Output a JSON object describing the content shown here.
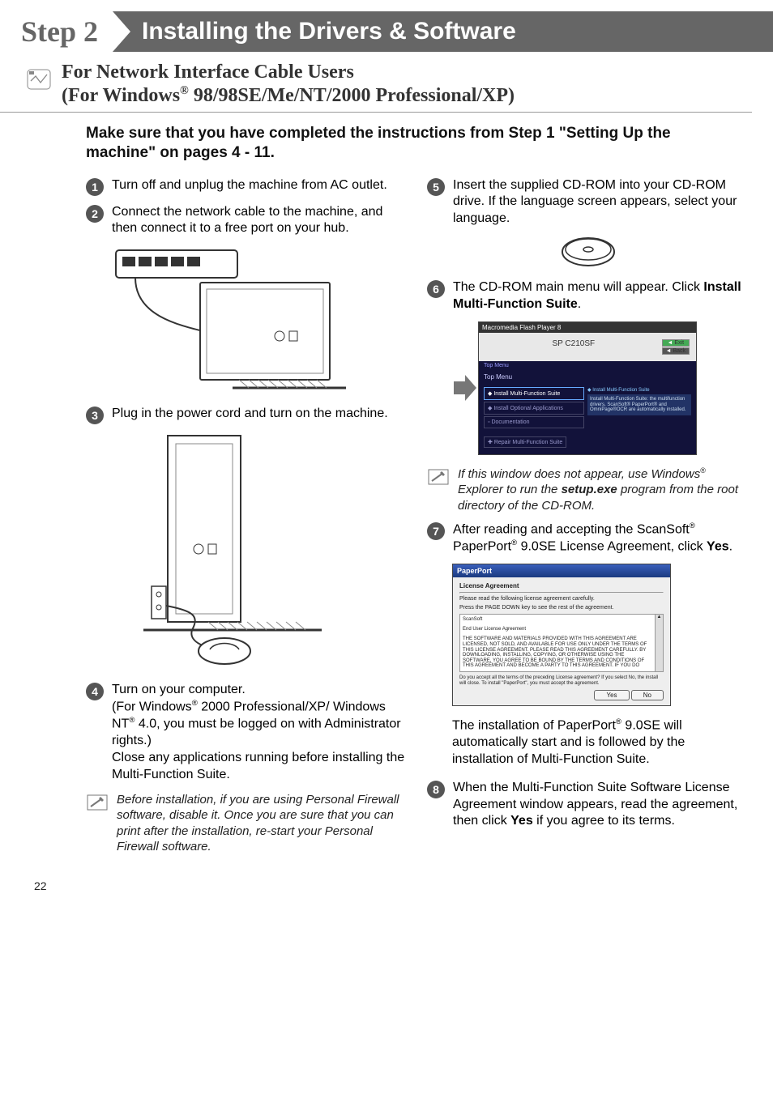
{
  "header": {
    "step_label": "Step 2",
    "title": "Installing the Drivers & Software"
  },
  "subhead": {
    "line1": "For Network Interface Cable Users",
    "line2_pre": "(For Windows",
    "line2_post": " 98/98SE/Me/NT/2000 Professional/XP)"
  },
  "intro": "Make sure that you have completed the instructions from Step 1 \"Setting Up the machine\" on pages 4 - 11.",
  "left": {
    "s1": "Turn off and unplug the machine from AC outlet.",
    "s2": "Connect the network cable to the machine, and then connect it to a free port on your hub.",
    "s3": "Plug in the power cord and turn on the machine.",
    "s4_a": "Turn on your computer.",
    "s4_b_pre": "(For Windows",
    "s4_b_mid": " 2000 Professional/XP/ Windows NT",
    "s4_b_post": " 4.0, you must be logged on with Administrator rights.)",
    "s4_c": "Close any applications running before installing the Multi-Function Suite.",
    "note": "Before installation, if you are using Personal Firewall software, disable it. Once you are sure that you can print after the installation, re-start your Personal Firewall software."
  },
  "right": {
    "s5": "Insert the supplied CD-ROM into your CD-ROM drive. If the language screen appears, select your language.",
    "s6_a": "The CD-ROM main menu will appear. Click ",
    "s6_b": "Install Multi-Function Suite",
    "s6_c": ".",
    "note_a": "If this window does not appear, use Windows",
    "note_b": " Explorer to run the ",
    "note_c": "setup.exe",
    "note_d": " program from the root directory of the CD-ROM.",
    "s7_a": "After reading and accepting the ScanSoft",
    "s7_b": " PaperPort",
    "s7_c": " 9.0SE License Agreement, click ",
    "s7_d": "Yes",
    "s7_e": ".",
    "under7_a": "The installation of PaperPort",
    "under7_b": " 9.0SE will automatically start and is followed by the installation of Multi-Function Suite.",
    "s8_a": "When the Multi-Function Suite Software License Agreement window appears, read the agreement, then click ",
    "s8_b": "Yes",
    "s8_c": " if you agree to its terms."
  },
  "screenshots": {
    "flash_title": "Macromedia Flash Player 8",
    "product": "SP C210SF",
    "top_menu": "Top Menu",
    "install_btn": "Install Multi-Function Suite",
    "install_opt": "Install Optional Applications",
    "documentation": "Documentation",
    "repair": "Repair Multi-Function Suite",
    "exit": "Exit",
    "back": "Back",
    "tooltip_title": "Install Multi-Function Suite",
    "tooltip_body": "Install Multi-Function Suite: the multifunction drivers, ScanSoft® PaperPort® and OmniPage®OCR are automatically installed.",
    "pp_title": "PaperPort",
    "pp_license": "License Agreement",
    "pp_read": "Please read the following license agreement carefully.",
    "pp_page": "Press the PAGE DOWN key to see the rest of the agreement.",
    "pp_scansoft": "ScanSoft",
    "pp_eula": "End User License Agreement",
    "pp_body": "THE SOFTWARE AND MATERIALS PROVIDED WITH THIS AGREEMENT ARE LICENSED, NOT SOLD, AND AVAILABLE FOR USE ONLY UNDER THE TERMS OF THIS LICENSE AGREEMENT. PLEASE READ THIS AGREEMENT CAREFULLY. BY DOWNLOADING, INSTALLING, COPYING, OR OTHERWISE USING THE SOFTWARE, YOU AGREE TO BE BOUND BY THE TERMS AND CONDITIONS OF THIS AGREEMENT AND BECOME A PARTY TO THIS AGREEMENT. IF YOU DO",
    "pp_q": "Do you accept all the terms of the preceding License agreement? If you select No, the install will close. To install \"PaperPort\", you must accept the agreement.",
    "yes": "Yes",
    "no": "No"
  },
  "page_number": "22"
}
